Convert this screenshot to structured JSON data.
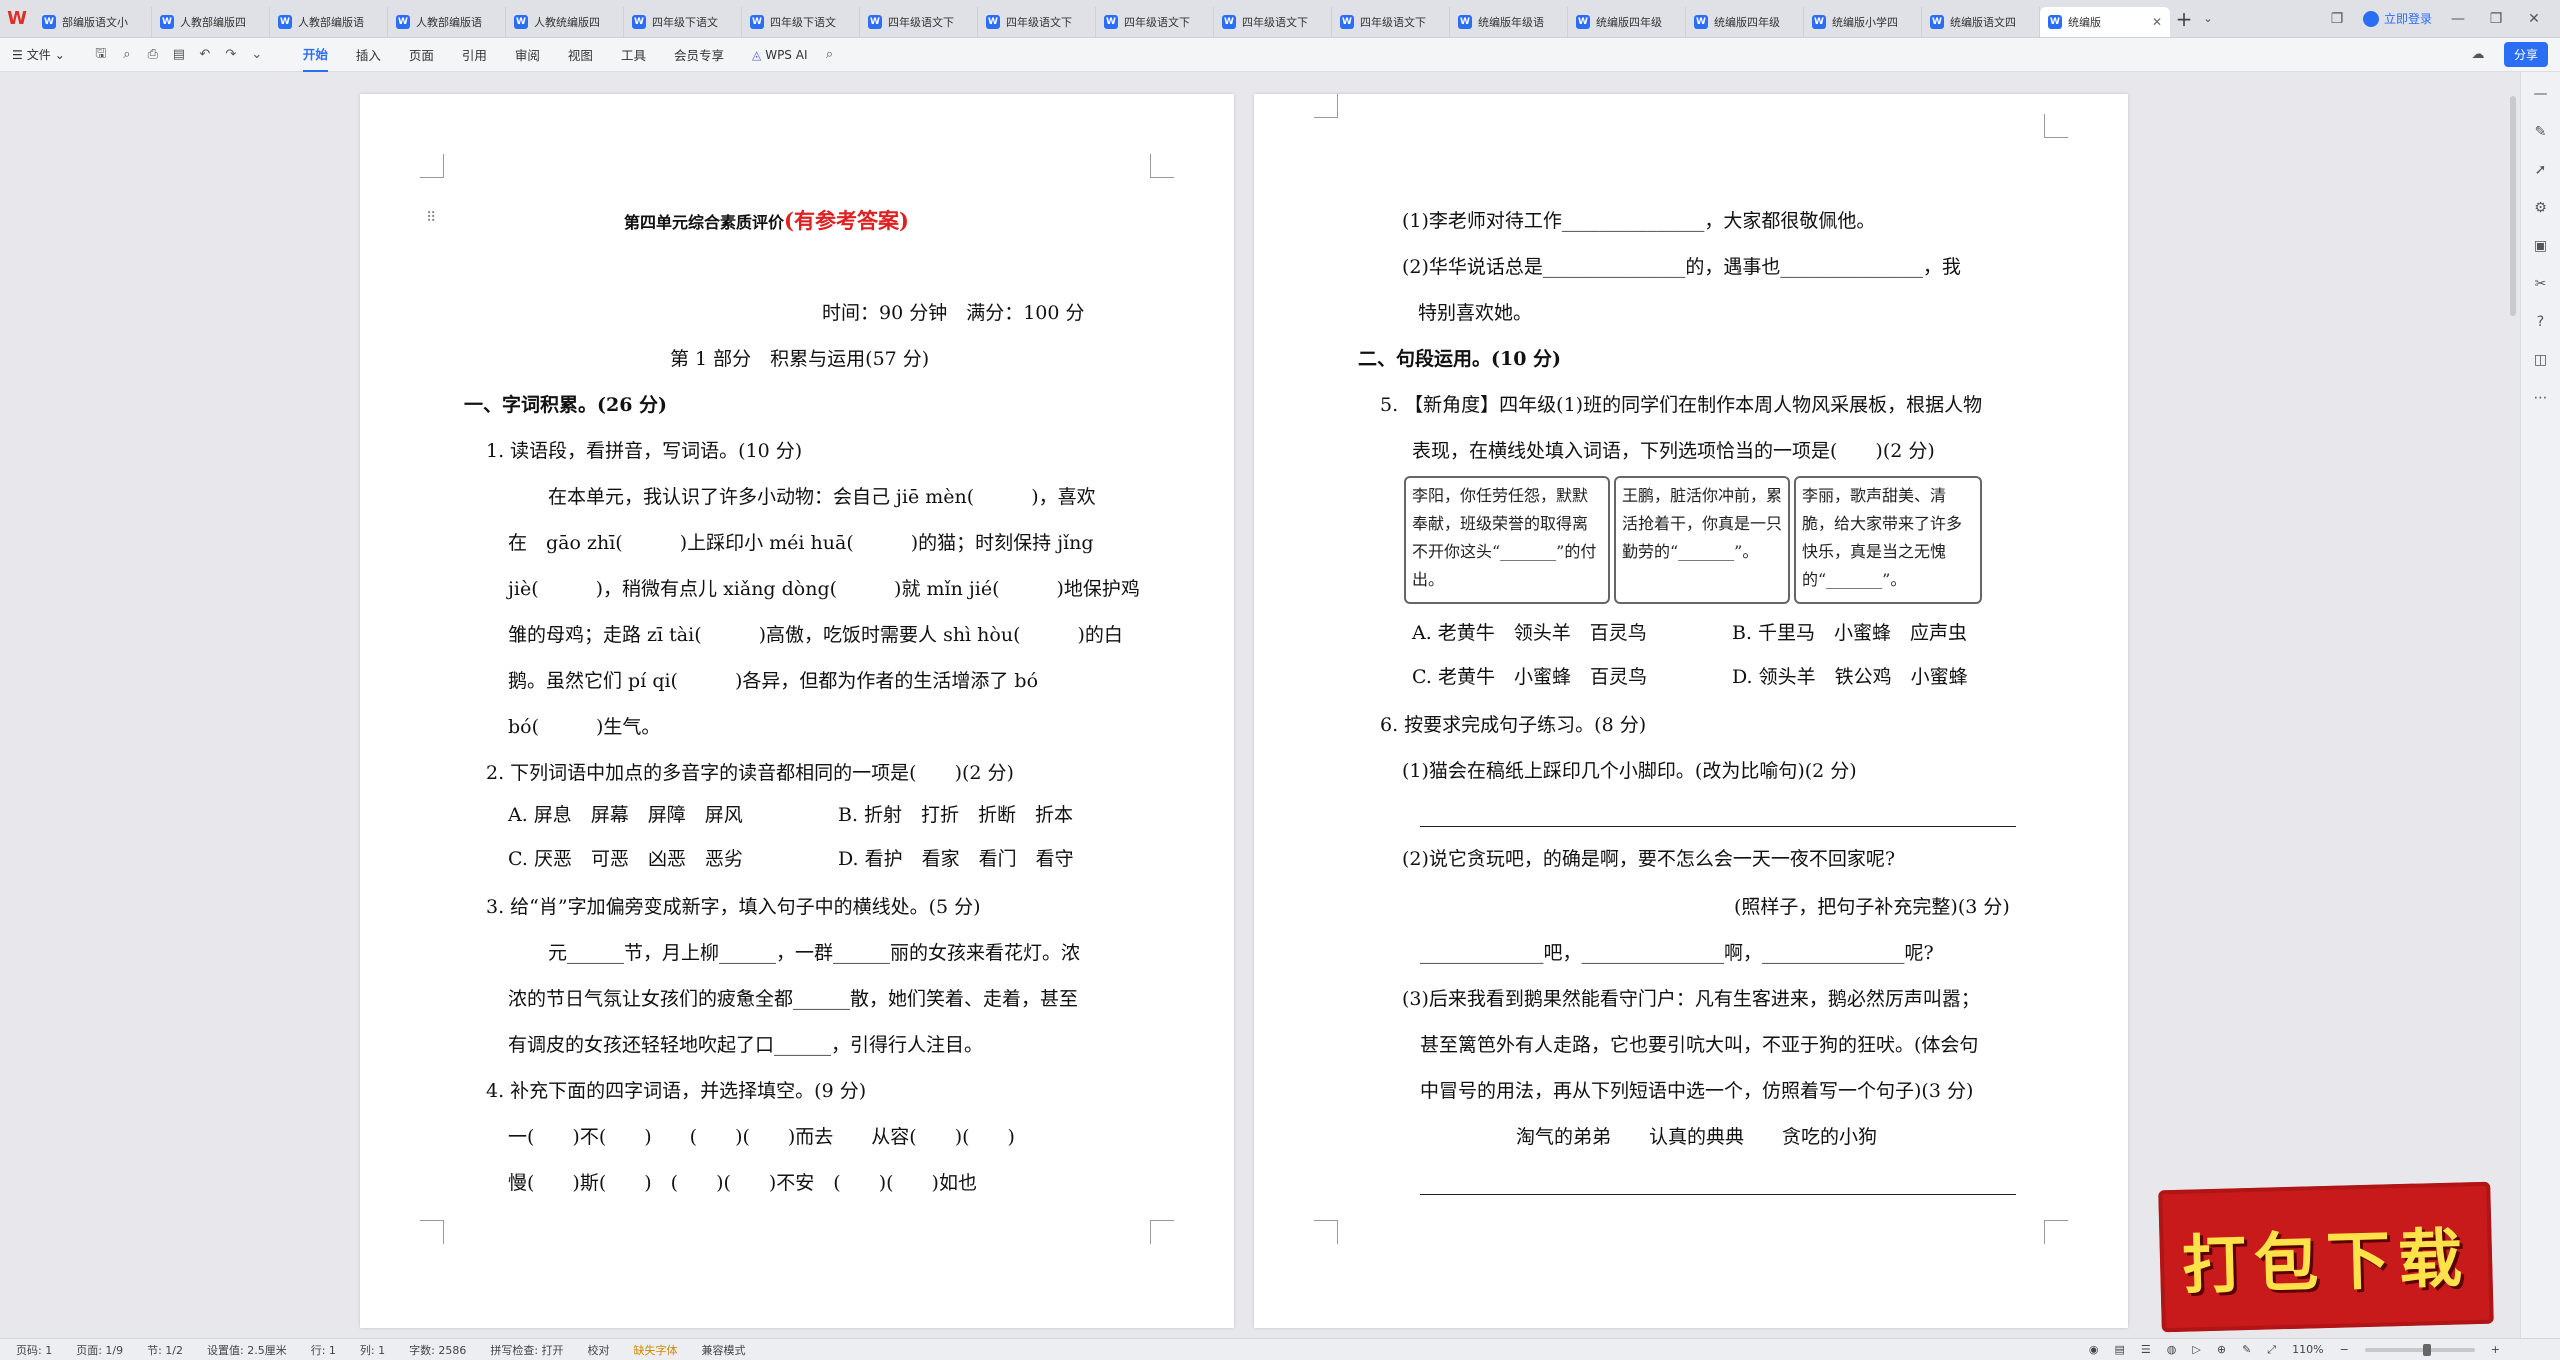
{
  "tabs": [
    {
      "label": "部编版语文小"
    },
    {
      "label": "人教部编版四"
    },
    {
      "label": "人教部编版语"
    },
    {
      "label": "人教部编版语"
    },
    {
      "label": "人教统编版四"
    },
    {
      "label": "四年级下语文"
    },
    {
      "label": "四年级下语文"
    },
    {
      "label": "四年级语文下"
    },
    {
      "label": "四年级语文下"
    },
    {
      "label": "四年级语文下"
    },
    {
      "label": "四年级语文下"
    },
    {
      "label": "四年级语文下"
    },
    {
      "label": "统编版年级语"
    },
    {
      "label": "统编版四年级"
    },
    {
      "label": "统编版四年级"
    },
    {
      "label": "统编版小学四"
    },
    {
      "label": "统编版语文四"
    },
    {
      "label": "统编版"
    }
  ],
  "titlebar": {
    "login": "立即登录"
  },
  "ribbon": {
    "file": "文件",
    "menus": [
      "开始",
      "插入",
      "页面",
      "引用",
      "审阅",
      "视图",
      "工具",
      "会员专享"
    ],
    "active_menu": "开始",
    "ai": "WPS AI",
    "share": "分享"
  },
  "left_page": {
    "title": "第四单元综合素质评价",
    "title_red": "(有参考答案)",
    "time": "时间：90 分钟　满分：100 分",
    "part1": "第 1 部分　积累与运用(57 分)",
    "sec1": "一、字词积累。(26 分)",
    "q1": "1. 读语段，看拼音，写词语。(10 分)",
    "q1_l1": "在本单元，我认识了许多小动物：会自己 jiē mèn(　　　)，喜欢",
    "q1_l2": "在　gāo zhī(　　　)上踩印小 méi huā(　　　)的猫；时刻保持 jǐng",
    "q1_l3": "jiè(　　　)，稍微有点儿 xiǎng dòng(　　　)就 mǐn jié(　　　)地保护鸡",
    "q1_l4": "雏的母鸡；走路 zī tài(　　　)高傲，吃饭时需要人 shì hòu(　　　)的白",
    "q1_l5": "鹅。虽然它们 pí qi(　　　)各异，但都为作者的生活增添了 bó",
    "q1_l6": "bó(　　　)生气。",
    "q2": "2. 下列词语中加点的多音字的读音都相同的一项是(　　)(2 分)",
    "q2_a": "A. 屏息　屏幕　屏障　屏风",
    "q2_b": "B. 折射　打折　折断　折本",
    "q2_c": "C. 厌恶　可恶　凶恶　恶劣",
    "q2_d": "D. 看护　看家　看门　看守",
    "q3": "3. 给“肖”字加偏旁变成新字，填入句子中的横线处。(5 分)",
    "q3_l1": "元______节，月上柳______，一群______丽的女孩来看花灯。浓",
    "q3_l2": "浓的节日气氛让女孩们的疲惫全都______散，她们笑着、走着，甚至",
    "q3_l3": "有调皮的女孩还轻轻地吹起了口______，引得行人注目。",
    "q4": "4. 补充下面的四字词语，并选择填空。(9 分)",
    "q4_l1": "一(　　)不(　　)　　(　　)(　　)而去　　从容(　　)(　　)",
    "q4_l2": "慢(　　)斯(　　)　(　　)(　　)不安　(　　)(　　)如也"
  },
  "right_page": {
    "q4_s1": "(1)李老师对待工作_______________，大家都很敬佩他。",
    "q4_s2": "(2)华华说话总是_______________的，遇事也_______________，我",
    "q4_s2b": "特别喜欢她。",
    "sec2": "二、句段运用。(10 分)",
    "q5_l1": "5. 【新角度】四年级(1)班的同学们在制作本周人物风采展板，根据人物",
    "q5_l2": "表现，在横线处填入词语，下列选项恰当的一项是(　　)(2 分)",
    "box1": "李阳，你任劳任怨，默默奉献，班级荣誉的取得离不开你这头“_______”的付出。",
    "box2": "王鹏，脏活你冲前，累活抢着干，你真是一只勤劳的“_______”。",
    "box3": "李丽，歌声甜美、清脆，给大家带来了许多快乐，真是当之无愧的“_______”。",
    "q5_a": "A. 老黄牛　领头羊　百灵鸟",
    "q5_b": "B. 千里马　小蜜蜂　应声虫",
    "q5_c": "C. 老黄牛　小蜜蜂　百灵鸟",
    "q5_d": "D. 领头羊　铁公鸡　小蜜蜂",
    "q6": "6. 按要求完成句子练习。(8 分)",
    "q6_1": "(1)猫会在稿纸上踩印几个小脚印。(改为比喻句)(2 分)",
    "q6_2": "(2)说它贪玩吧，的确是啊，要不怎么会一天一夜不回家呢?",
    "q6_2r": "(照样子，把句子补充完整)(3 分)",
    "q6_2a": "_____________吧，_______________啊，_______________呢?",
    "q6_3_l1": "(3)后来我看到鹅果然能看守门户：凡有生客进来，鹅必然厉声叫嚣；",
    "q6_3_l2": "甚至篱笆外有人走路，它也要引吭大叫，不亚于狗的狂吠。(体会句",
    "q6_3_l3": "中冒号的用法，再从下列短语中选一个，仿照着写一个句子)(3 分)",
    "q6_3_opts": "淘气的弟弟　　认真的典典　　贪吃的小狗"
  },
  "statusbar": {
    "page_num": "页码: 1",
    "pages": "页面: 1/9",
    "section": "节: 1/2",
    "setting": "设置值: 2.5厘米",
    "row": "行: 1",
    "col": "列: 1",
    "words": "字数: 2586",
    "spell": "拼写检查: 打开",
    "proof": "校对",
    "missing_font": "缺失字体",
    "compat": "兼容模式",
    "zoom": "110%"
  },
  "download_badge": "打包下载",
  "colors": {
    "accent": "#2b6ef6",
    "title_red": "#e02020",
    "badge_red": "#c81a1a",
    "badge_text": "#ffe14a"
  }
}
